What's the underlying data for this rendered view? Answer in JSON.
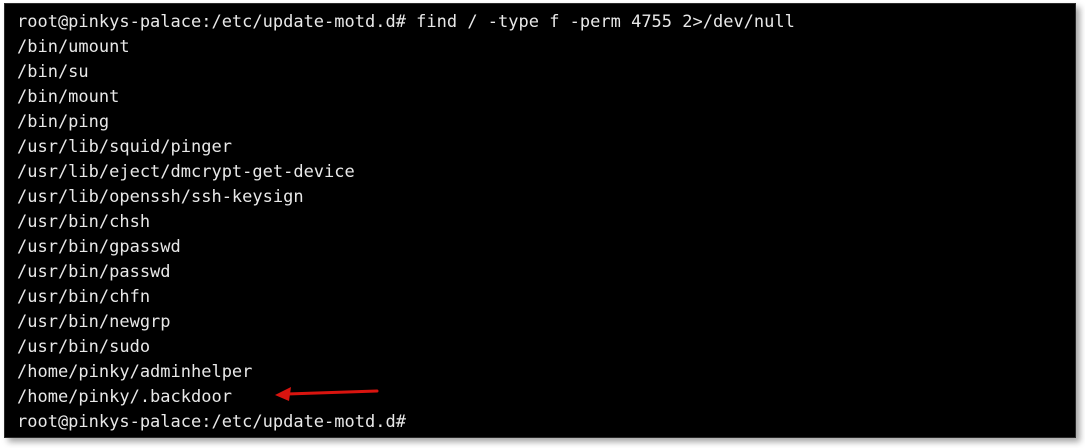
{
  "terminal": {
    "lines": [
      "root@pinkys-palace:/etc/update-motd.d# find / -type f -perm 4755 2>/dev/null",
      "/bin/umount",
      "/bin/su",
      "/bin/mount",
      "/bin/ping",
      "/usr/lib/squid/pinger",
      "/usr/lib/eject/dmcrypt-get-device",
      "/usr/lib/openssh/ssh-keysign",
      "/usr/bin/chsh",
      "/usr/bin/gpasswd",
      "/usr/bin/passwd",
      "/usr/bin/chfn",
      "/usr/bin/newgrp",
      "/usr/bin/sudo",
      "/home/pinky/adminhelper",
      "/home/pinky/.backdoor",
      "root@pinkys-palace:/etc/update-motd.d#"
    ]
  },
  "annotation": {
    "arrow_color": "#d9140f",
    "icon": "red-arrow-left-icon"
  },
  "colors": {
    "background": "#000000",
    "text": "#e8e8e8"
  }
}
